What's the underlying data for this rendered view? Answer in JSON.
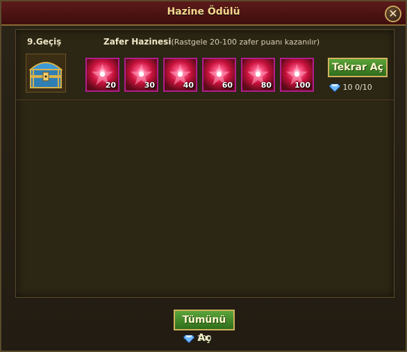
{
  "window": {
    "title": "Hazine Ödülü",
    "close_label": "✕"
  },
  "row": {
    "pass_label": "9.Geçiş",
    "reward_name": "Zafer Hazinesi",
    "reward_note": "(Rastgele 20-100 zafer puanı kazanılır)",
    "rewards": [
      {
        "value": "20"
      },
      {
        "value": "30"
      },
      {
        "value": "40"
      },
      {
        "value": "60"
      },
      {
        "value": "80"
      },
      {
        "value": "100"
      }
    ],
    "again_button": "Tekrar Aç",
    "gem_cost": "10",
    "attempts": "0/10"
  },
  "footer": {
    "open_all_button": "Tümünü Aç",
    "total_cost": "100"
  },
  "colors": {
    "accent": "#d2b25e",
    "button_green": "#4a8f2e",
    "slot_border": "#b01d8e"
  }
}
